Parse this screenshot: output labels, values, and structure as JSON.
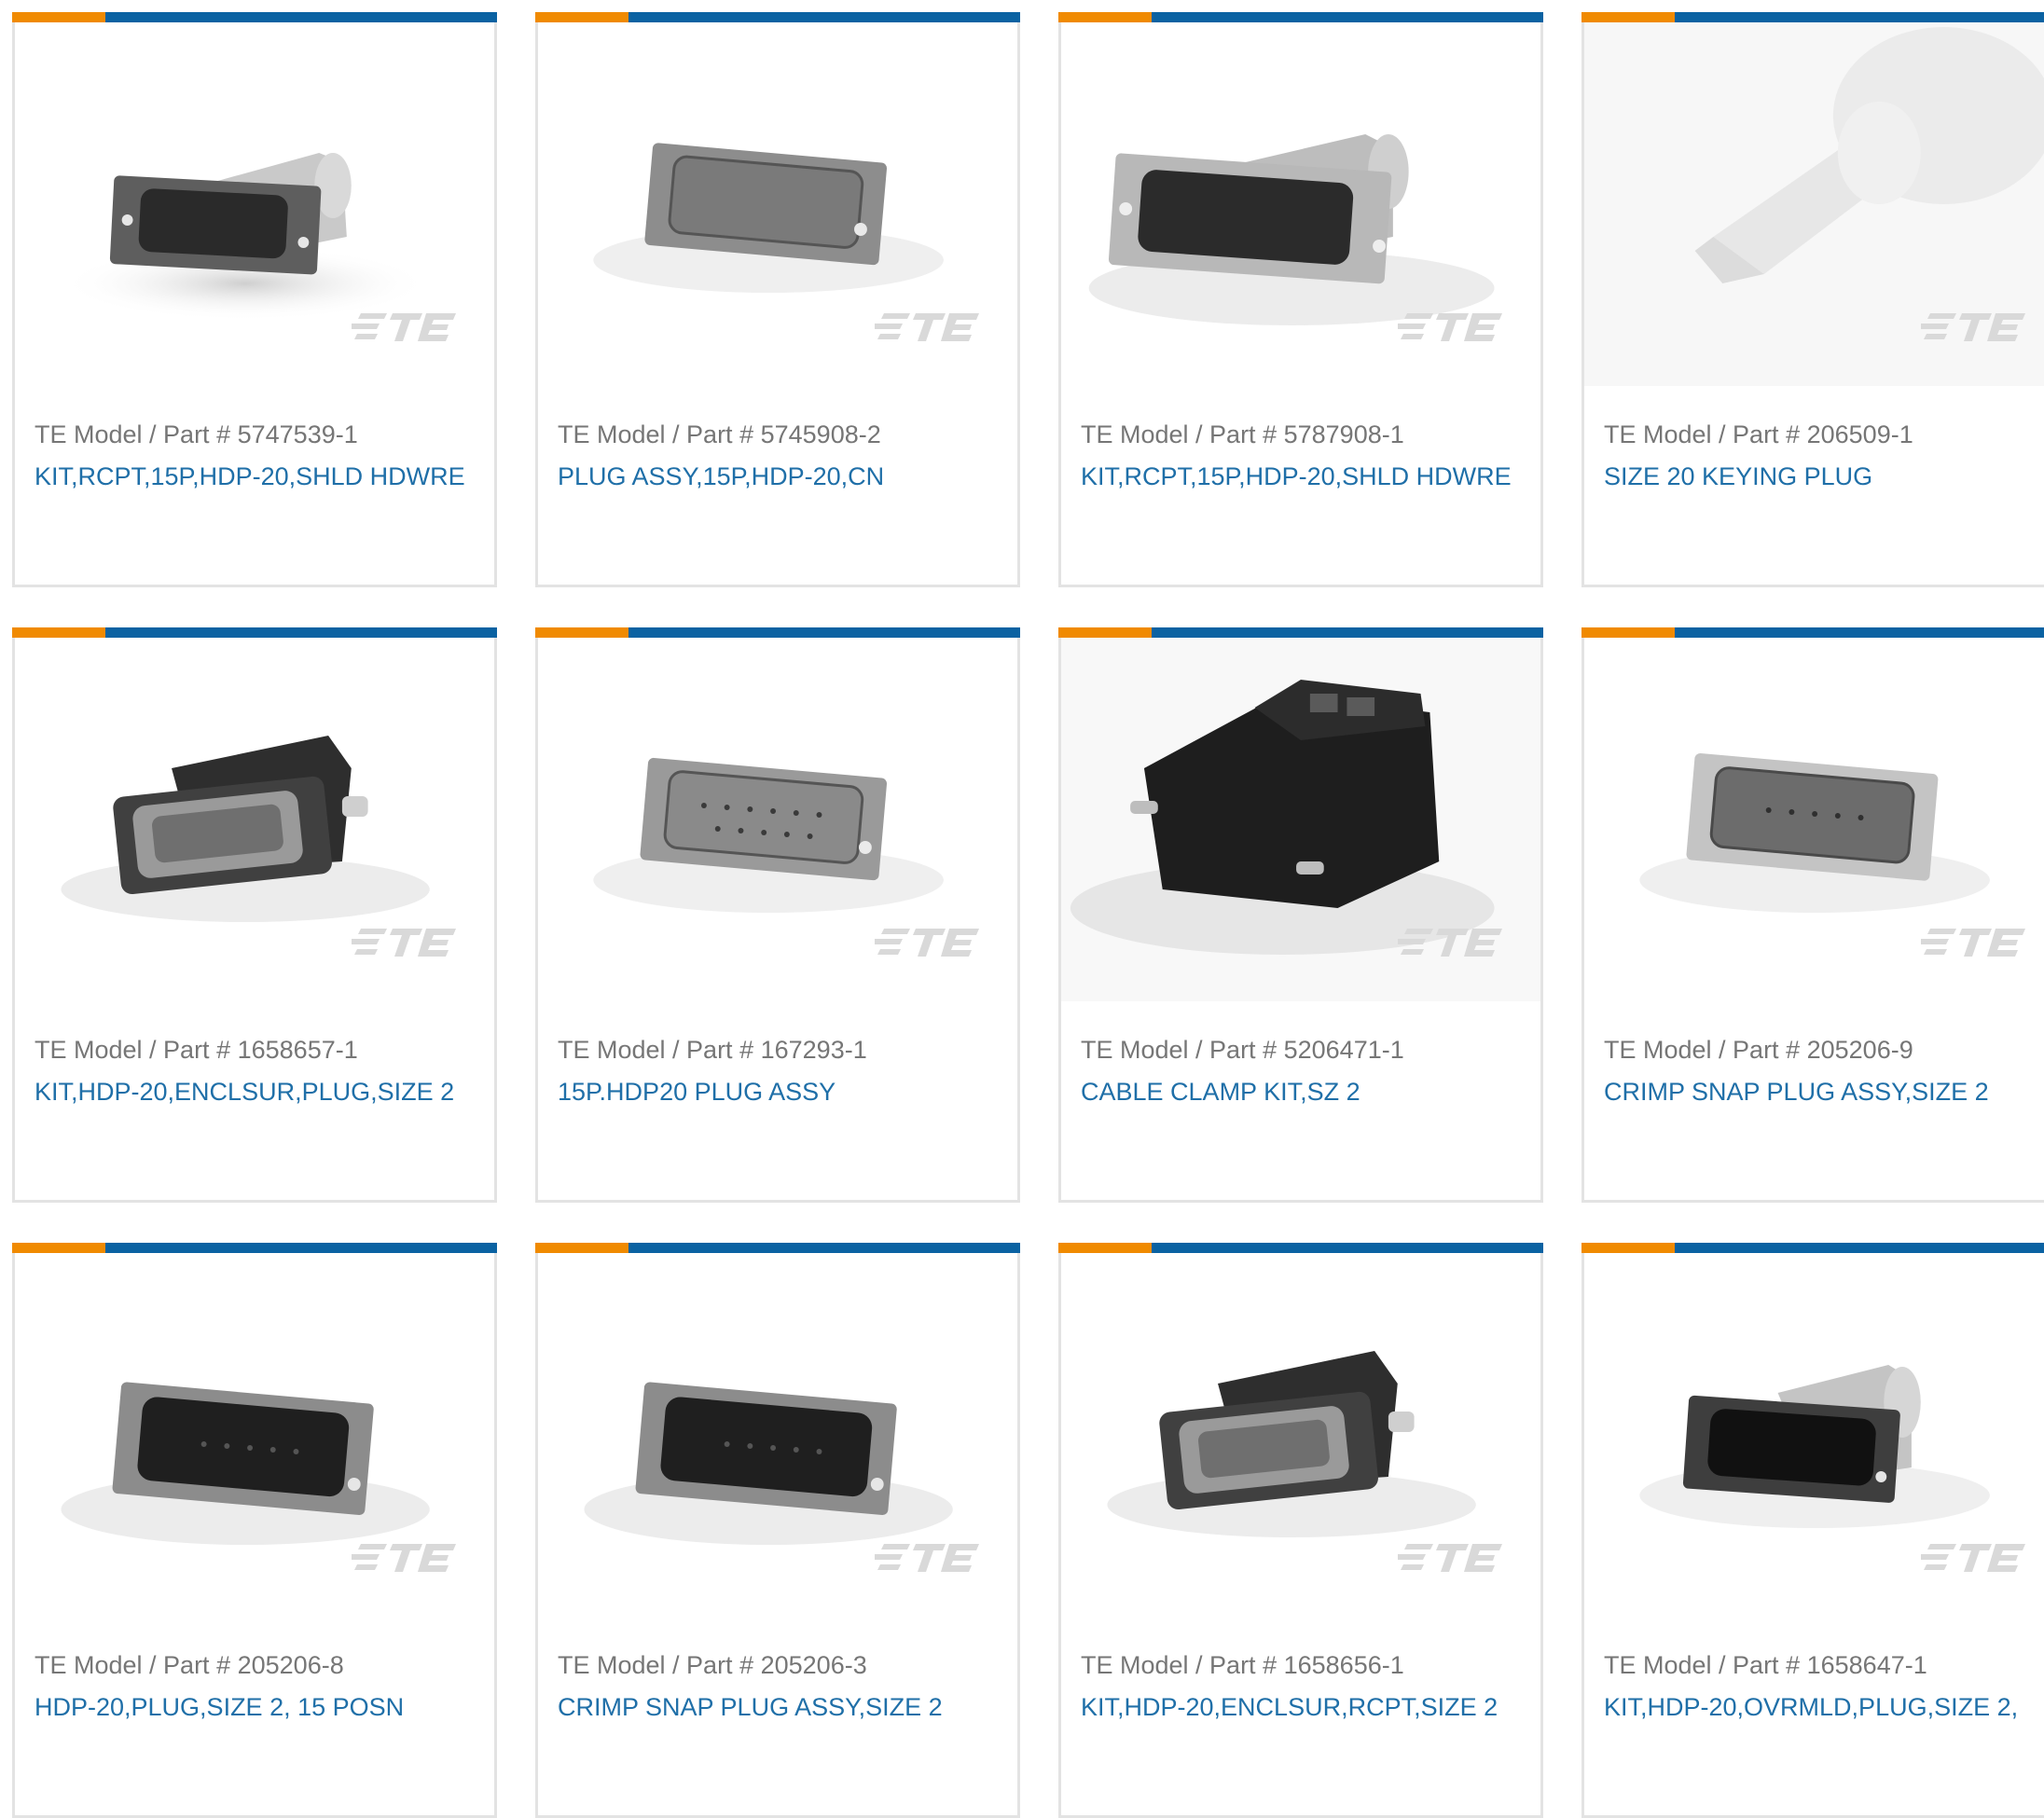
{
  "theme": {
    "accent_orange": "#f08a00",
    "accent_blue": "#0a62a2",
    "link_color": "#1f6fa8",
    "label_color": "#767676",
    "watermark_color": "#d9d9d9"
  },
  "part_label_prefix": "TE Model / Part #",
  "cards": [
    {
      "part_number": "5747539-1",
      "description": "KIT,RCPT,15P,HDP-20,SHLD HDWRE",
      "image": "d-sub-receptacle-metal-backshell"
    },
    {
      "part_number": "5745908-2",
      "description": "PLUG ASSY,15P,HDP-20,CN",
      "image": "d-sub-plug-shell"
    },
    {
      "part_number": "5787908-1",
      "description": "KIT,RCPT,15P,HDP-20,SHLD HDWRE",
      "image": "d-sub-receptacle-metal-backshell-large"
    },
    {
      "part_number": "206509-1",
      "description": "SIZE 20 KEYING PLUG",
      "image": "white-keying-plug"
    },
    {
      "part_number": "1658657-1",
      "description": "KIT,HDP-20,ENCLSUR,PLUG,SIZE 2",
      "image": "d-sub-black-enclosure"
    },
    {
      "part_number": "167293-1",
      "description": "15P.HDP20 PLUG ASSY",
      "image": "d-sub-plug-shell-pins"
    },
    {
      "part_number": "5206471-1",
      "description": "CABLE CLAMP KIT,SZ 2",
      "image": "black-cable-clamp-hood"
    },
    {
      "part_number": "205206-9",
      "description": "CRIMP SNAP PLUG ASSY,SIZE 2",
      "image": "d-sub-plug-chrome"
    },
    {
      "part_number": "205206-8",
      "description": "HDP-20,PLUG,SIZE 2, 15 POSN",
      "image": "d-sub-plug-black-insert"
    },
    {
      "part_number": "205206-3",
      "description": "CRIMP SNAP PLUG ASSY,SIZE 2",
      "image": "d-sub-plug-black-insert"
    },
    {
      "part_number": "1658656-1",
      "description": "KIT,HDP-20,ENCLSUR,RCPT,SIZE 2",
      "image": "d-sub-black-enclosure"
    },
    {
      "part_number": "1658647-1",
      "description": "KIT,HDP-20,OVRMLD,PLUG,SIZE 2,",
      "image": "d-sub-overmold-plug"
    }
  ]
}
